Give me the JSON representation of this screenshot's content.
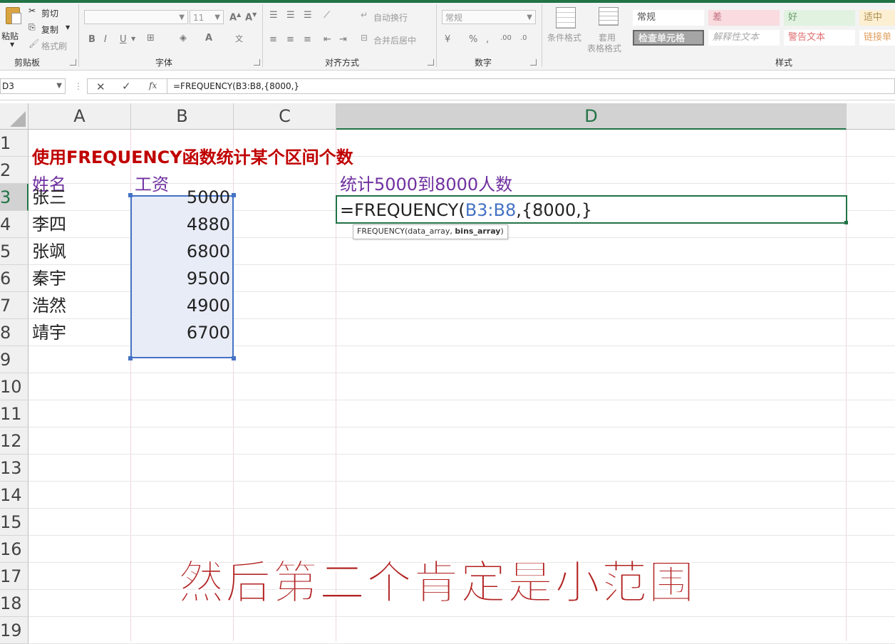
{
  "ribbon": {
    "clipboard": {
      "paste": "粘贴",
      "cut": "剪切",
      "copy": "复制",
      "format_painter": "格式刷",
      "label": "剪贴板"
    },
    "font": {
      "size": "11",
      "label": "字体"
    },
    "alignment": {
      "wrap_text": "自动换行",
      "merge_center": "合并后居中",
      "label": "对齐方式"
    },
    "number": {
      "format": "常规",
      "label": "数字"
    },
    "styles": {
      "conditional_format": "条件格式",
      "table_format_1": "套用",
      "table_format_2": "表格格式",
      "normal": "常规",
      "bad": "差",
      "good": "好",
      "neutral": "适中",
      "check_cell": "检查单元格",
      "explanatory": "解释性文本",
      "warning": "警告文本",
      "linked": "链接单",
      "label": "样式"
    }
  },
  "formula_bar": {
    "name_box": "D3",
    "formula": "=FREQUENCY(B3:B8,{8000,}"
  },
  "columns": [
    "A",
    "B",
    "C",
    "D"
  ],
  "rows": [
    "1",
    "2",
    "3",
    "4",
    "5",
    "6",
    "7",
    "8",
    "9",
    "10",
    "11",
    "12",
    "13",
    "14",
    "15",
    "16",
    "17",
    "18",
    "19"
  ],
  "sheet": {
    "title": "使用FREQUENCY函数统计某个区间个数",
    "header_name": "姓名",
    "header_salary": "工资",
    "stat_label": "统计5000到8000人数",
    "edit_prefix": "=FREQUENCY(",
    "edit_ref": "B3:B8",
    "edit_suffix": ",{8000,}",
    "tooltip_fn": "FREQUENCY(data_array, ",
    "tooltip_arg": "bins_array",
    "tooltip_close": ")",
    "data": [
      {
        "name": "张三",
        "salary": "5000"
      },
      {
        "name": "李四",
        "salary": "4880"
      },
      {
        "name": "张飒",
        "salary": "6800"
      },
      {
        "name": "秦宇",
        "salary": "9500"
      },
      {
        "name": "浩然",
        "salary": "4900"
      },
      {
        "name": "靖宇",
        "salary": "6700"
      }
    ]
  },
  "subtitle": "然后第二个肯定是小范围",
  "colors": {
    "accent": "#217346",
    "title_red": "#c00000",
    "purple": "#7030a0",
    "range_blue": "#4472c4",
    "subtitle": "#b22222"
  }
}
